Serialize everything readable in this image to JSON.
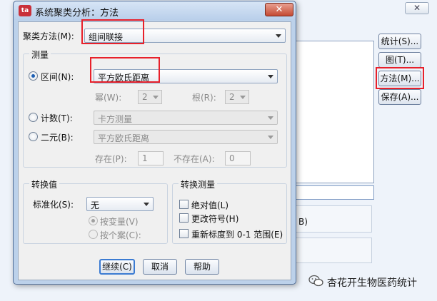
{
  "parent": {
    "close_glyph": "✕",
    "buttons": {
      "stats": "统计(S)...",
      "plots": "图(T)...",
      "method": "方法(M)...",
      "save": "保存(A)..."
    },
    "hidden_label_suffix": "B)"
  },
  "dialog": {
    "app_icon_text": "ta",
    "title": "系统聚类分析：方法",
    "close_glyph": "✕",
    "cluster_method": {
      "label": "聚类方法(M):",
      "value": "组间联接"
    },
    "measure": {
      "group_title": "测量",
      "interval": {
        "label": "区间(N):",
        "selected": true,
        "value": "平方欧氏距离",
        "power_label": "幂(W):",
        "power_value": "2",
        "root_label": "根(R):",
        "root_value": "2"
      },
      "counts": {
        "label": "计数(T):",
        "selected": false,
        "value": "卡方测量"
      },
      "binary": {
        "label": "二元(B):",
        "selected": false,
        "value": "平方欧氏距离",
        "present_label": "存在(P):",
        "present_value": "1",
        "absent_label": "不存在(A):",
        "absent_value": "0"
      }
    },
    "transform_values": {
      "group_title": "转换值",
      "standardize_label": "标准化(S):",
      "standardize_value": "无",
      "by_variable": "按变量(V)",
      "by_case": "按个案(C):",
      "by_variable_selected": true
    },
    "transform_measures": {
      "group_title": "转换测量",
      "absolute": "绝对值(L)",
      "change_sign": "更改符号(H)",
      "rescale": "重新标度到 0-1 范围(E)"
    },
    "buttons": {
      "continue": "继续(C)",
      "cancel": "取消",
      "help": "帮助"
    }
  },
  "watermark": {
    "text": "杏花开生物医药统计"
  },
  "colors": {
    "highlight_box": "#e8202a",
    "titlebar": "#bcd1ea",
    "close_button": "#c54a33"
  }
}
